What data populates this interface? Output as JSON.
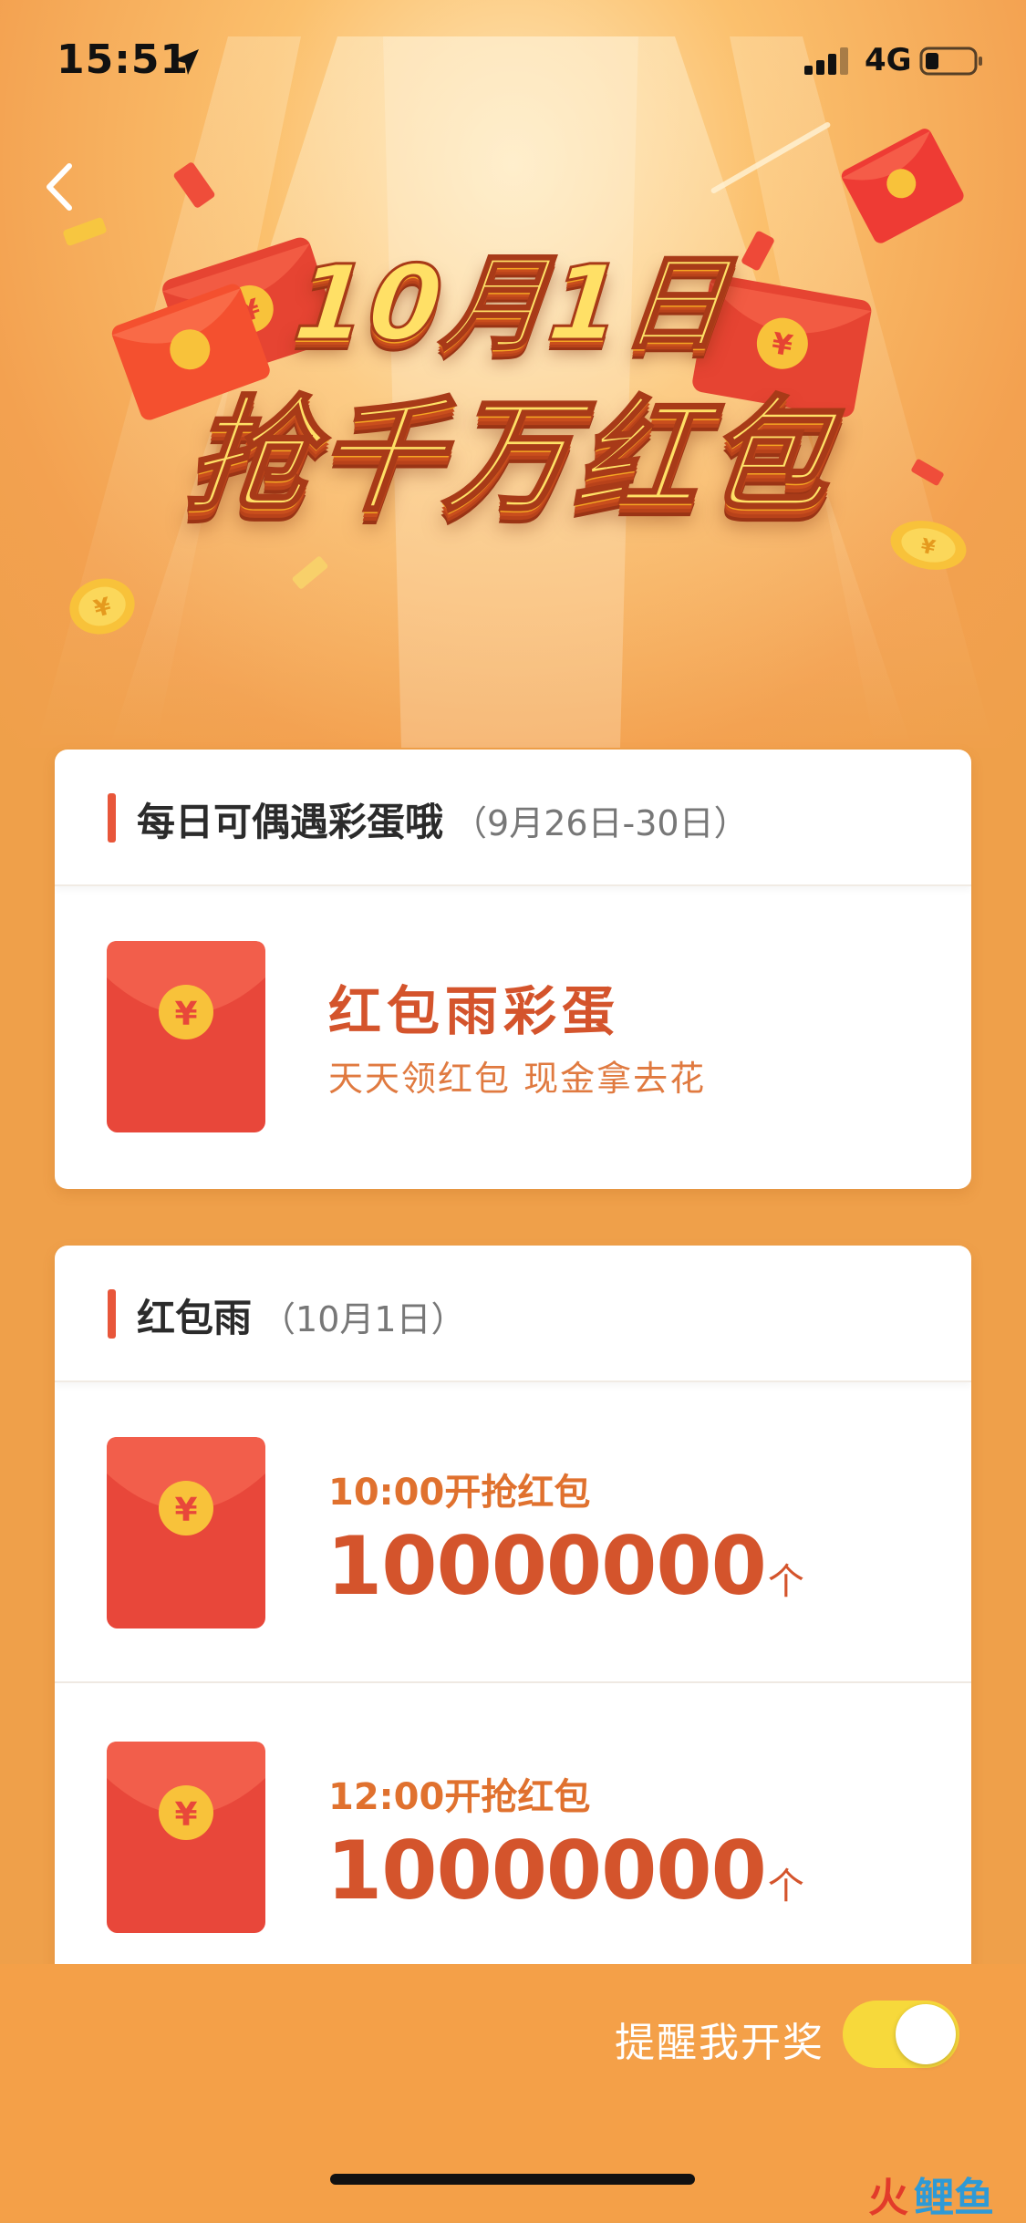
{
  "status_bar": {
    "time": "15:51",
    "network": "4G",
    "icons": [
      "location-arrow-icon",
      "signal-icon",
      "battery-icon"
    ]
  },
  "nav": {
    "back_icon": "chevron-left-icon"
  },
  "banner": {
    "title": "10月1日",
    "subtitle": "抢千万红包"
  },
  "daily_card": {
    "title": "每日可偶遇彩蛋哦",
    "date_range": "（9月26日-30日）",
    "item": {
      "icon": "red-envelope-icon",
      "title": "红包雨彩蛋",
      "description": "天天领红包 现金拿去花"
    }
  },
  "rain_card": {
    "title": "红包雨",
    "date": "（10月1日）",
    "items": [
      {
        "icon": "red-envelope-icon",
        "time_label": "10:00开抢红包",
        "count": "10000000",
        "unit": "个"
      },
      {
        "icon": "red-envelope-icon",
        "time_label": "12:00开抢红包",
        "count": "10000000",
        "unit": "个"
      }
    ]
  },
  "bottom_bar": {
    "remind_label": "提醒我开奖",
    "toggle_on": true
  },
  "watermark": {
    "fire": "火",
    "text": "鲤鱼"
  },
  "colors": {
    "background": "#efa04a",
    "accent_red": "#d4542c",
    "accent_orange": "#e0712e",
    "toggle_on": "#f7d93b",
    "header_accent": "#e8563a"
  }
}
